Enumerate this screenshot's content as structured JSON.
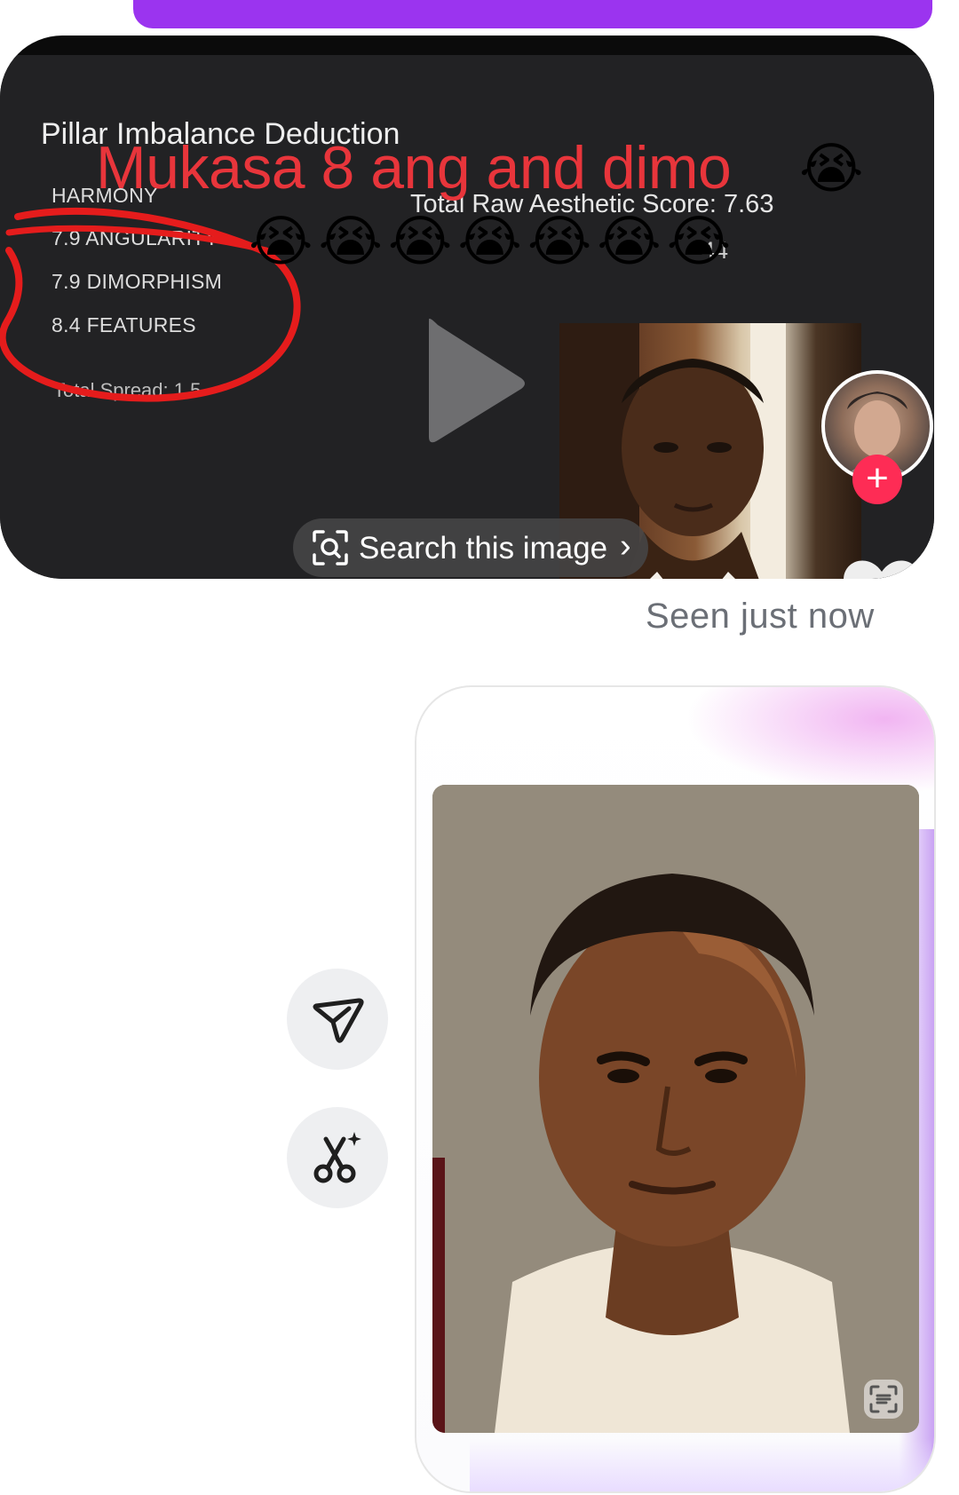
{
  "video_post": {
    "slide_title": "Pillar Imbalance Deduction",
    "pillars": [
      "HARMONY",
      "7.9 ANGULARITY",
      "7.9 DIMORPHISM",
      "8.4 FEATURES"
    ],
    "total_raw_score": "Total Raw Aesthetic Score: 7.63",
    "partial_line_end": "44",
    "total_spread": "Total Spread: 1.5",
    "caption": "Mukasa 8 ang and dimo",
    "caption_emoji": "😭",
    "emoji_row": [
      "😭",
      "😭",
      "😭",
      "😭",
      "😭",
      "😭",
      "😭"
    ],
    "search_label": "Search this image",
    "search_chevron": "›",
    "plus_label": "+"
  },
  "status": {
    "seen": "Seen just now"
  },
  "actions": {
    "send_icon": "send-icon",
    "cut_icon": "scissors-sparkle-icon"
  },
  "colors": {
    "accent_purple": "#9b34ef",
    "caption_red": "#e8353b",
    "tiktok_pink": "#fe2c55",
    "seen_gray": "#6b6f76"
  }
}
